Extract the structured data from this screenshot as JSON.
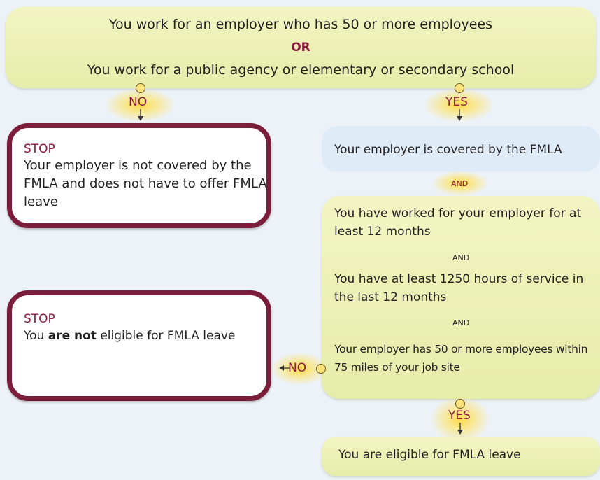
{
  "top": {
    "line1": "You work for an employer who has 50 or more employees",
    "or": "OR",
    "line2": "You work for a public agency or elementary or secondary school"
  },
  "labels": {
    "no_top": "NO",
    "yes_top": "YES",
    "and_1": "AND",
    "and_2": "AND",
    "and_3": "AND",
    "no_mid": "NO",
    "yes_bottom": "YES"
  },
  "stop1": {
    "title": "STOP",
    "text": "Your employer is not covered by the FMLA and does not have to offer FMLA leave"
  },
  "covered": {
    "text": "Your employer is covered by the FMLA"
  },
  "criteria": {
    "c1": "You have worked for your employer for at least 12 months",
    "c2": "You have at least 1250 hours of service in the last 12 months",
    "c3": "Your employer has 50 or more employees within 75 miles of your job site"
  },
  "stop2": {
    "title": "STOP",
    "text_pre": "You ",
    "text_bold": "are not",
    "text_post": " eligible for FMLA leave"
  },
  "eligible": {
    "text": "You are eligible for FMLA leave"
  },
  "colors": {
    "accent": "#8b1a3f",
    "green_box": "#e6ecaa",
    "blue_box": "#dfecf7",
    "glow": "#ffd628"
  }
}
